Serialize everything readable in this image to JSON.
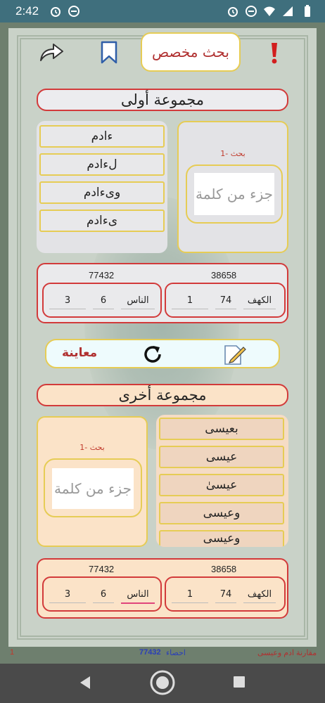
{
  "status_bar": {
    "time": "2:42"
  },
  "header": {
    "title": "بحث مخصص"
  },
  "group1": {
    "title": "مجموعة أولى",
    "words": [
      "ءادم",
      "لءادم",
      "وىءادم",
      "ىءادم"
    ],
    "search_label": "1- بحث",
    "search_placeholder": "جزء من كلمة",
    "stats": {
      "count_right": "38658",
      "count_left": "77432",
      "right": {
        "sura": "الكهف",
        "verse": "74",
        "num": "1"
      },
      "left": {
        "sura": "الناس",
        "verse": "6",
        "num": "3"
      }
    }
  },
  "actions": {
    "preview_label": "معاينة"
  },
  "group2": {
    "title": "مجموعة أخرى",
    "words": [
      "بعيسى",
      "عيسى",
      "عيسىٰ",
      "وعيسى",
      "وعيسى"
    ],
    "search_label": "1- بحث",
    "search_placeholder": "جزء من كلمة",
    "stats": {
      "count_right": "38658",
      "count_left": "77432",
      "right": {
        "sura": "الكهف",
        "verse": "74",
        "num": "1"
      },
      "left": {
        "sura": "الناس",
        "verse": "6",
        "num": "3"
      }
    }
  },
  "footer": {
    "comparison": "مقارنة ادم وعيسى",
    "stat_label": "احصاء",
    "stat_value": "77432",
    "page": "1"
  },
  "colors": {
    "accent_red": "#d23a3a",
    "border_gold": "#e6cc55",
    "group2_bg": "#fbe3c8",
    "group1_bg": "#e3e3e6"
  }
}
